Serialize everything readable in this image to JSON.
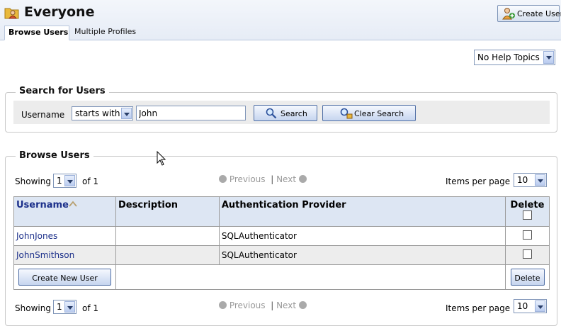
{
  "header": {
    "title": "Everyone",
    "create_user_label": "Create User",
    "tabs": [
      {
        "label": "Browse Users",
        "active": true
      },
      {
        "label": "Multiple Profiles",
        "active": false
      }
    ]
  },
  "help": {
    "selected": "No Help Topics"
  },
  "search": {
    "legend": "Search for Users",
    "username_label": "Username",
    "match_mode": "starts with",
    "value": "John",
    "search_label": "Search",
    "clear_label": "Clear Search"
  },
  "browse": {
    "legend": "Browse Users",
    "showing_label": "Showing",
    "page": "1",
    "of_label": "of 1",
    "previous_label": "Previous",
    "next_label": "Next",
    "items_per_page_label": "Items per page",
    "items_per_page": "10",
    "columns": [
      "Username",
      "Description",
      "Authentication Provider",
      "Delete"
    ],
    "rows": [
      {
        "username": "JohnJones",
        "description": "",
        "provider": "SQLAuthenticator"
      },
      {
        "username": "JohnSmithson",
        "description": "",
        "provider": "SQLAuthenticator"
      }
    ],
    "create_new_user_label": "Create New User",
    "delete_label": "Delete"
  },
  "colors": {
    "accent": "#1b2f8a",
    "header_bg": "#e6ecf6",
    "row_alt": "#ededed"
  }
}
